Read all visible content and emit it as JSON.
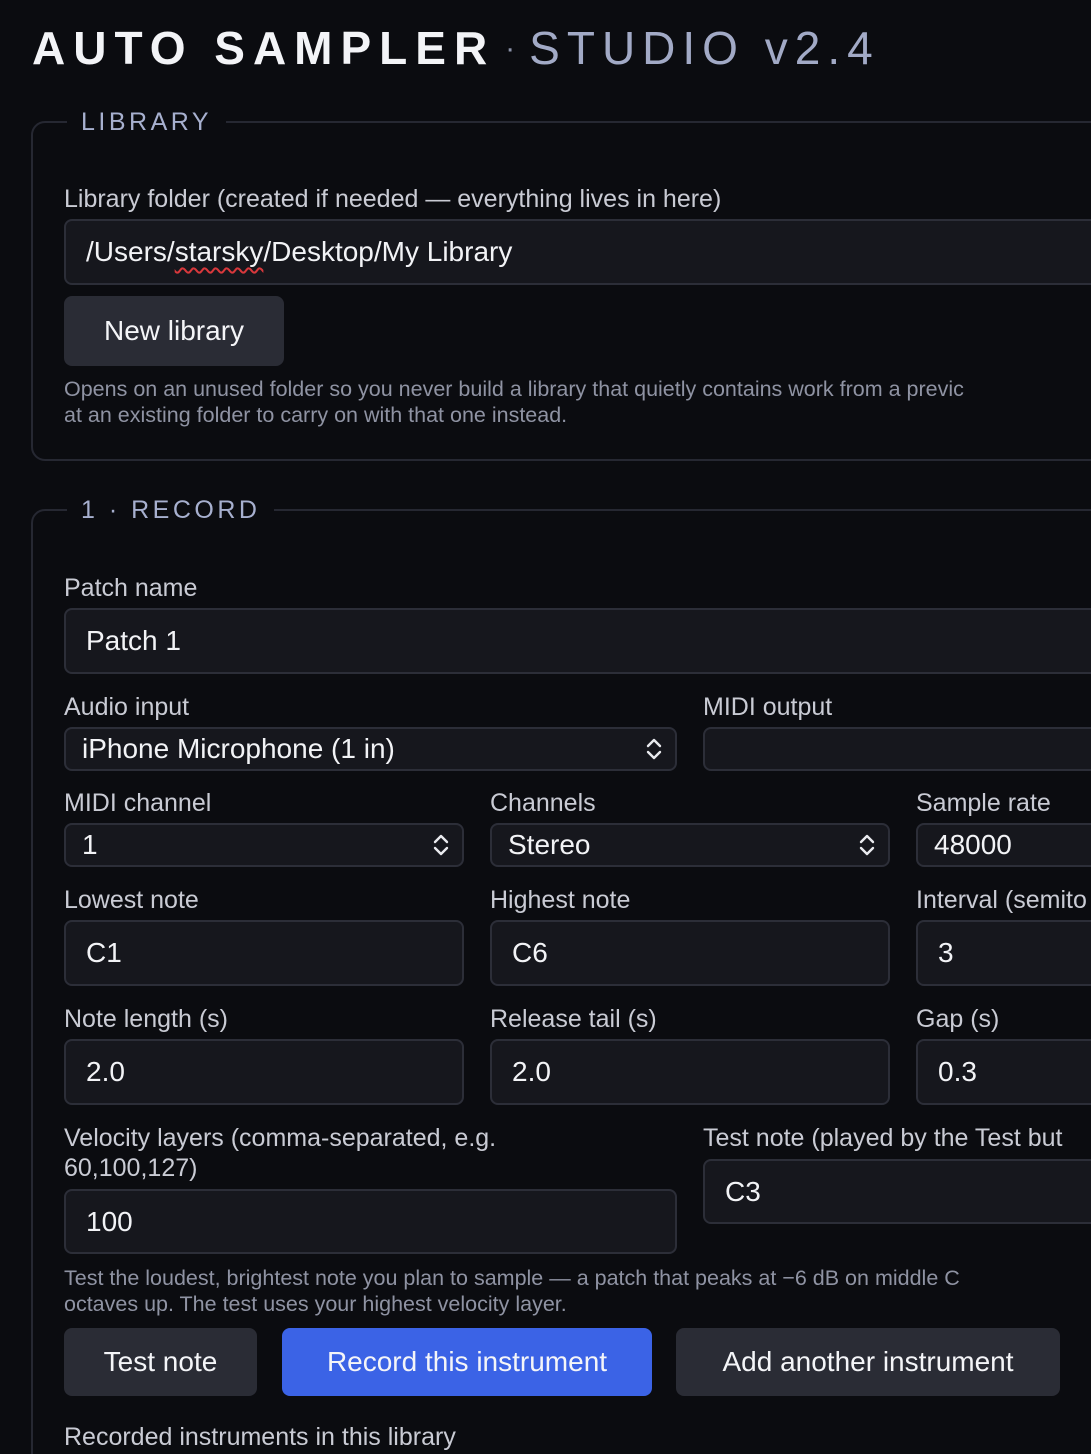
{
  "header": {
    "brand": "AUTO SAMPLER",
    "separator": "·",
    "subtitle": "STUDIO v2.4"
  },
  "library": {
    "legend": "LIBRARY",
    "folder_label": "Library folder (created if needed — everything lives in here)",
    "folder_value_prefix": "/Users/",
    "folder_value_misspelled": "starsky",
    "folder_value_suffix": "/Desktop/My Library",
    "new_library_label": "New library",
    "hint_line1": "Opens on an unused folder so you never build a library that quietly contains work from a previc",
    "hint_line2": "at an existing folder to carry on with that one instead."
  },
  "record": {
    "legend": "1 · RECORD",
    "patch_name_label": "Patch name",
    "patch_name_value": "Patch 1",
    "audio_input_label": "Audio input",
    "audio_input_value": "iPhone Microphone (1 in)",
    "midi_output_label": "MIDI output",
    "midi_output_value": "",
    "midi_channel_label": "MIDI channel",
    "midi_channel_value": "1",
    "channels_label": "Channels",
    "channels_value": "Stereo",
    "sample_rate_label": "Sample rate",
    "sample_rate_value": "48000",
    "lowest_note_label": "Lowest note",
    "lowest_note_value": "C1",
    "highest_note_label": "Highest note",
    "highest_note_value": "C6",
    "interval_label": "Interval (semito",
    "interval_value": "3",
    "note_length_label": "Note length (s)",
    "note_length_value": "2.0",
    "release_tail_label": "Release tail (s)",
    "release_tail_value": "2.0",
    "gap_label": "Gap (s)",
    "gap_value": "0.3",
    "velocity_label_line1": "Velocity layers (comma-separated, e.g.",
    "velocity_label_line2": "60,100,127)",
    "velocity_value": "100",
    "test_note_label": "Test note (played by the Test but",
    "test_note_value": "C3",
    "hint_line1": "Test the loudest, brightest note you plan to sample — a patch that peaks at −6 dB on middle C",
    "hint_line2": "octaves up. The test uses your highest velocity layer.",
    "test_note_button": "Test note",
    "record_button": "Record this instrument",
    "add_button": "Add another instrument",
    "recorded_heading": "Recorded instruments in this library"
  },
  "colors": {
    "background": "#0b0c10",
    "accent": "#3b63e6",
    "legend": "#a7b0cf"
  }
}
